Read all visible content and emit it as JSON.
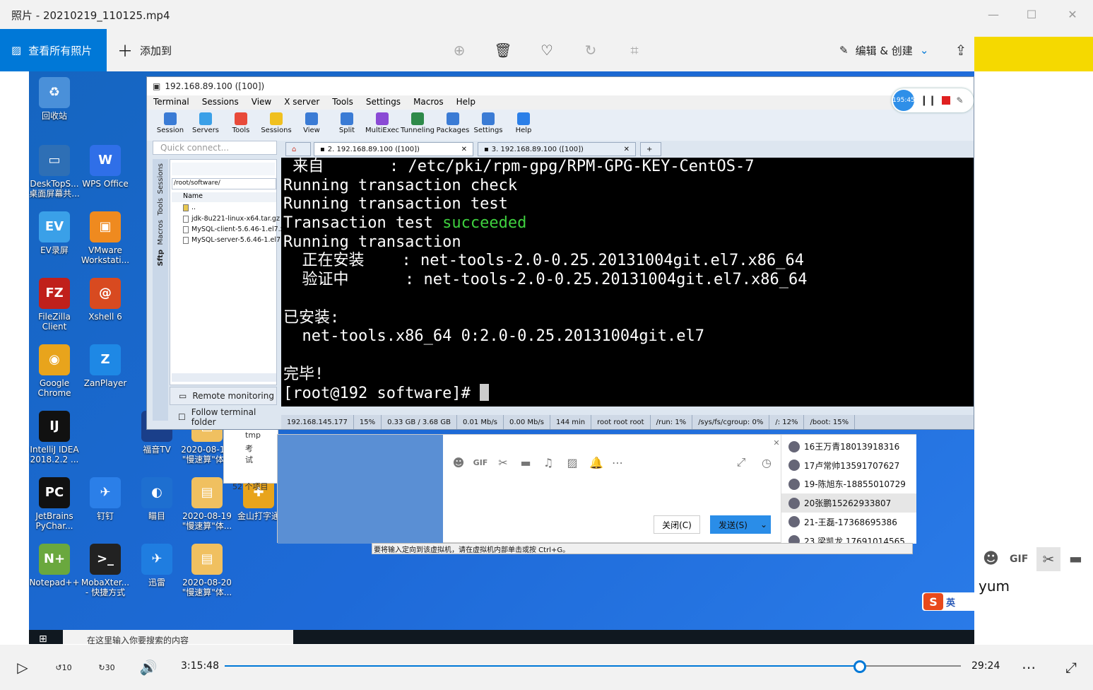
{
  "window": {
    "title": "照片 - 20210219_110125.mp4"
  },
  "toolbar": {
    "view_all": "查看所有照片",
    "add_to": "添加到",
    "edit_create": "编辑 & 创建"
  },
  "desktop": {
    "icons": [
      {
        "label": "回收站",
        "color": "#4a90d9",
        "glyph": "♻"
      },
      {
        "label": "DeskTopS... 桌面屏幕共...",
        "color": "#2e6fb5",
        "glyph": "▭"
      },
      {
        "label": "WPS Office",
        "color": "#2f6fe8",
        "glyph": "W"
      },
      {
        "label": "EV录屏",
        "color": "#3aa0e8",
        "glyph": "EV"
      },
      {
        "label": "VMware Workstati...",
        "color": "#ef8a1f",
        "glyph": "▣"
      },
      {
        "label": "FileZilla Client",
        "color": "#c0201b",
        "glyph": "FZ"
      },
      {
        "label": "Xshell 6",
        "color": "#d84a20",
        "glyph": "@"
      },
      {
        "label": "Google Chrome",
        "color": "#e8a41c",
        "glyph": "◉"
      },
      {
        "label": "ZanPlayer",
        "color": "#1e88e5",
        "glyph": "Z"
      },
      {
        "label": "IntelliJ IDEA 2018.2.2 ...",
        "color": "#111111",
        "glyph": "IJ"
      },
      {
        "label": "福音TV",
        "color": "#1a3f8a",
        "glyph": "TV"
      },
      {
        "label": "2020-08-1... \"慢速算\"体...",
        "color": "#f0c060",
        "glyph": "▤"
      },
      {
        "label": "JetBrains PyChar...",
        "color": "#111111",
        "glyph": "PC"
      },
      {
        "label": "钉钉",
        "color": "#2b7fe8",
        "glyph": "✈"
      },
      {
        "label": "瞄目",
        "color": "#1e6fd0",
        "glyph": "◐"
      },
      {
        "label": "2020-08-19 \"慢速算\"体...",
        "color": "#f0c060",
        "glyph": "▤"
      },
      {
        "label": "金山打字通",
        "color": "#e8a41c",
        "glyph": "✚"
      },
      {
        "label": "Notepad++",
        "color": "#6aa83e",
        "glyph": "N+"
      },
      {
        "label": "MobaXter... - 快捷方式",
        "color": "#222222",
        "glyph": ">_"
      },
      {
        "label": "迅雷",
        "color": "#1f7de0",
        "glyph": "✈"
      },
      {
        "label": "2020-08-20 \"慢速算\"体...",
        "color": "#f0c060",
        "glyph": "▤"
      }
    ]
  },
  "moba": {
    "title": "192.168.89.100 ([100])",
    "menu": [
      "Terminal",
      "Sessions",
      "View",
      "X server",
      "Tools",
      "Settings",
      "Macros",
      "Help"
    ],
    "tools": [
      {
        "label": "Session",
        "color": "#3a7bd5"
      },
      {
        "label": "Servers",
        "color": "#3aa0e8"
      },
      {
        "label": "Tools",
        "color": "#e84a3a"
      },
      {
        "label": "Sessions",
        "color": "#f0c020"
      },
      {
        "label": "View",
        "color": "#3a7bd5"
      },
      {
        "label": "Split",
        "color": "#3a7bd5"
      },
      {
        "label": "MultiExec",
        "color": "#8a4ad5"
      },
      {
        "label": "Tunneling",
        "color": "#2e8a4a"
      },
      {
        "label": "Packages",
        "color": "#3a7bd5"
      },
      {
        "label": "Settings",
        "color": "#3a7bd5"
      },
      {
        "label": "Help",
        "color": "#2b7fe8"
      }
    ],
    "quick_connect": "Quick connect...",
    "tabs": [
      "2. 192.168.89.100 ([100])",
      "3. 192.168.89.100 ([100])"
    ],
    "side_tabs": [
      "Sessions",
      "Tools",
      "Macros",
      "Sftp"
    ],
    "sftp_path": "/root/software/",
    "sftp_header": "Name",
    "files": [
      "..",
      "jdk-8u221-linux-x64.tar.gz",
      "MySQL-client-5.6.46-1.el7.x",
      "MySQL-server-5.6.46-1.el7.x"
    ],
    "remote_monitoring": "Remote monitoring",
    "follow_folder": "Follow terminal folder",
    "terminal": {
      "l1": " 来自       : /etc/pki/rpm-gpg/RPM-GPG-KEY-CentOS-7",
      "l2": "Running transaction check",
      "l3": "Running transaction test",
      "l4a": "Transaction test ",
      "l4b": "succeeded",
      "l5": "Running transaction",
      "l6": "  正在安装    : net-tools-2.0-0.25.20131004git.el7.x86_64",
      "l7": "  验证中      : net-tools-2.0-0.25.20131004git.el7.x86_64",
      "l8": "",
      "l9": "已安装:",
      "l10": "  net-tools.x86_64 0:2.0-0.25.20131004git.el7",
      "l11": "",
      "l12": "完毕!",
      "l13": "[root@192 software]# "
    },
    "status": [
      "192.168.145.177",
      "15%",
      "0.33 GB / 3.68 GB",
      "0.01 Mb/s",
      "0.00 Mb/s",
      "144 min",
      "root  root  root",
      "/run: 1%",
      "/sys/fs/cgroup: 0%",
      "/: 12%",
      "/boot: 15%"
    ],
    "recorder_time": "195:45"
  },
  "chat": {
    "close_label": "关闭(C)",
    "send_label": "发送(S)",
    "contacts": [
      {
        "name": "16王万青18013918316",
        "selected": false
      },
      {
        "name": "17卢常帅13591707627",
        "selected": false
      },
      {
        "name": "19-陈旭东-18855010729",
        "selected": false
      },
      {
        "name": "20张鹏15262933807",
        "selected": true
      },
      {
        "name": "21-王磊-17368695386",
        "selected": false
      },
      {
        "name": "23 梁凯龙 17691014565",
        "selected": false
      }
    ],
    "vm_hint": "要将输入定向到该虚拟机，请在虚拟机内部单击或按 Ctrl+G。"
  },
  "explorer": {
    "item1": "tmp",
    "item2": "考试",
    "count": "52 个项目"
  },
  "taskbar": {
    "search_placeholder": "在这里输入你要搜索的内容"
  },
  "rightpanel": {
    "ime_label": "英",
    "input_text": "yum"
  },
  "media": {
    "current_time": "3:15:48",
    "total_time": "29:24",
    "progress": 0.863,
    "rewind_label": "10",
    "forward_label": "30"
  }
}
